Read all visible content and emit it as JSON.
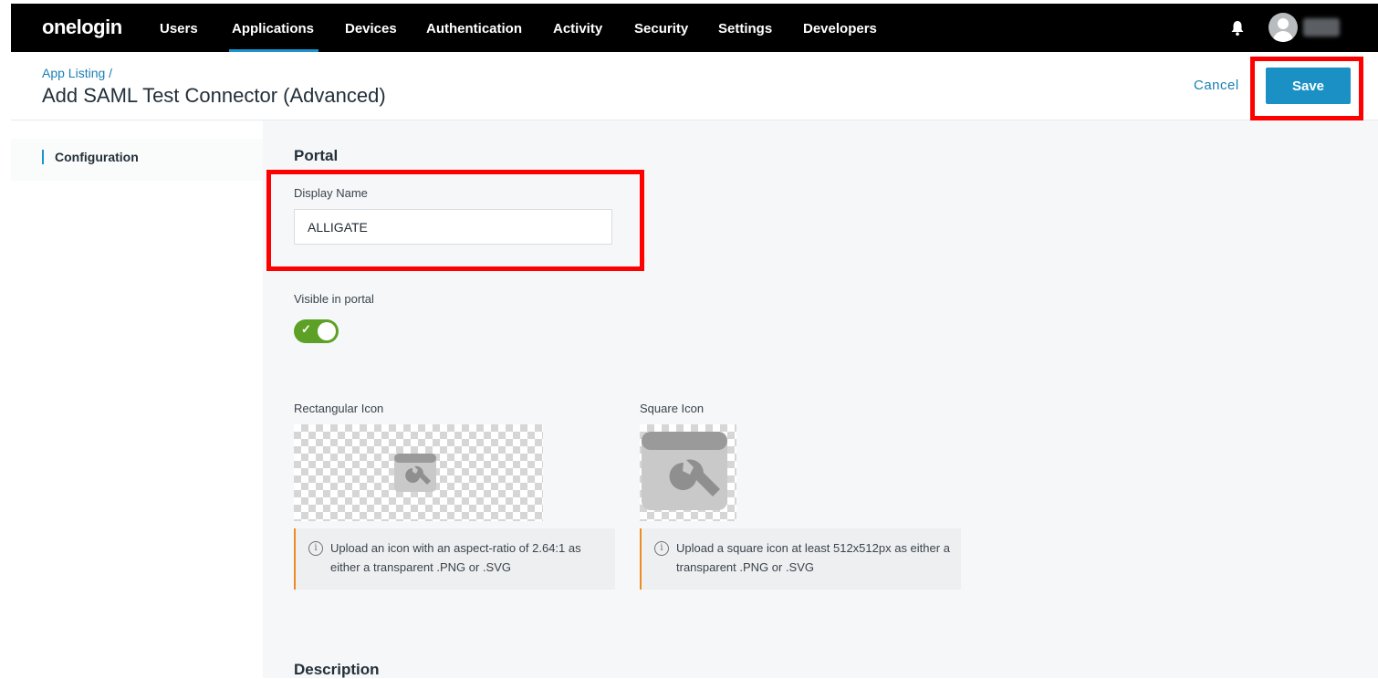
{
  "nav": {
    "logo": "onelogin",
    "items": [
      "Users",
      "Applications",
      "Devices",
      "Authentication",
      "Activity",
      "Security",
      "Settings",
      "Developers"
    ],
    "active": "Applications"
  },
  "header": {
    "breadcrumb": "App Listing /",
    "title": "Add SAML Test Connector (Advanced)",
    "cancel_label": "Cancel",
    "save_label": "Save"
  },
  "sidebar": {
    "items": [
      {
        "label": "Configuration",
        "active": true
      }
    ]
  },
  "portal": {
    "section_title": "Portal",
    "display_name_label": "Display Name",
    "display_name_value": "ALLIGATE",
    "visible_label": "Visible in portal",
    "visible_on": true,
    "rect_icon_label": "Rectangular Icon",
    "square_icon_label": "Square Icon",
    "rect_info": "Upload an icon with an aspect-ratio of 2.64:1 as either a transparent .PNG or .SVG",
    "square_info": "Upload a square icon at least 512x512px as either a transparent .PNG or .SVG"
  },
  "description": {
    "section_title": "Description"
  },
  "colors": {
    "accent": "#1a90c4",
    "toggle_on": "#5ca125",
    "highlight": "#ff0000",
    "info_border": "#f08a24"
  },
  "icons": [
    "bell-icon",
    "avatar-icon",
    "check-icon",
    "info-icon",
    "wrench-icon"
  ]
}
